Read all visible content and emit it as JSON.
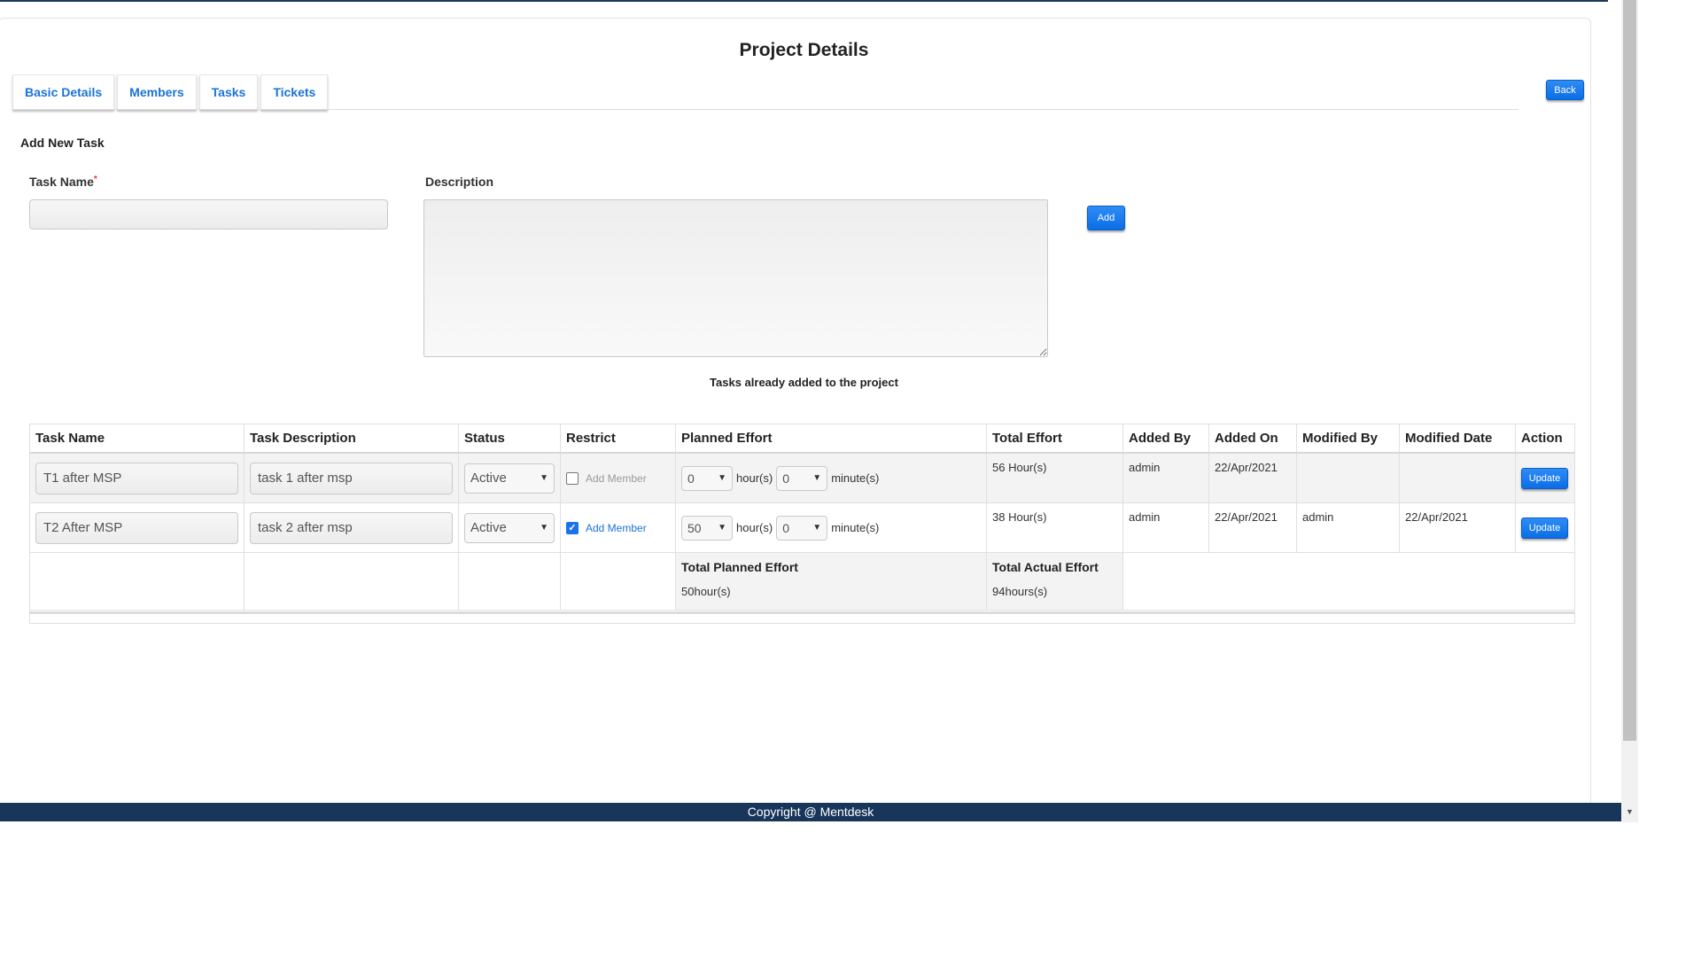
{
  "page": {
    "title": "Project Details",
    "back_label": "Back",
    "tabs": [
      {
        "label": "Basic Details"
      },
      {
        "label": "Members"
      },
      {
        "label": "Tasks"
      },
      {
        "label": "Tickets"
      }
    ]
  },
  "form": {
    "section_title": "Add New Task",
    "task_name_label": "Task Name",
    "required_mark": "*",
    "task_name_value": "",
    "description_label": "Description",
    "description_value": "",
    "add_label": "Add"
  },
  "tasks_table": {
    "caption": "Tasks already added to the project",
    "headers": [
      "Task Name",
      "Task Description",
      "Status",
      "Restrict",
      "Planned Effort",
      "Total Effort",
      "Added By",
      "Added On",
      "Modified By",
      "Modified Date",
      "Action"
    ],
    "rows": [
      {
        "task_name": "T1 after MSP",
        "task_description": "task 1 after msp",
        "status": "Active",
        "restrict_checked": false,
        "restrict_label": "Add Member",
        "planned_hours": "0",
        "hours_unit": "hour(s)",
        "planned_minutes": "0",
        "minutes_unit": "minute(s)",
        "total_effort": "56 Hour(s)",
        "added_by": "admin",
        "added_on": "22/Apr/2021",
        "modified_by": "",
        "modified_date": "",
        "action_label": "Update"
      },
      {
        "task_name": "T2 After MSP",
        "task_description": "task 2 after msp",
        "status": "Active",
        "restrict_checked": true,
        "restrict_label": "Add Member",
        "planned_hours": "50",
        "hours_unit": "hour(s)",
        "planned_minutes": "0",
        "minutes_unit": "minute(s)",
        "total_effort": "38 Hour(s)",
        "added_by": "admin",
        "added_on": "22/Apr/2021",
        "modified_by": "admin",
        "modified_date": "22/Apr/2021",
        "action_label": "Update"
      }
    ],
    "totals": {
      "planned_label": "Total Planned Effort",
      "planned_value": "50hour(s)",
      "actual_label": "Total Actual Effort",
      "actual_value": "94hours(s)"
    }
  },
  "footer": {
    "copyright": "Copyright @ Mentdesk"
  },
  "icons": {
    "dropdown": "chevron-down-icon",
    "checkbox": "checkbox-icon",
    "scroll_down": "scroll-down-arrow-icon"
  },
  "colors": {
    "accent": "#1a73d9",
    "button": "#0a6ee6",
    "footer": "#17365a"
  }
}
